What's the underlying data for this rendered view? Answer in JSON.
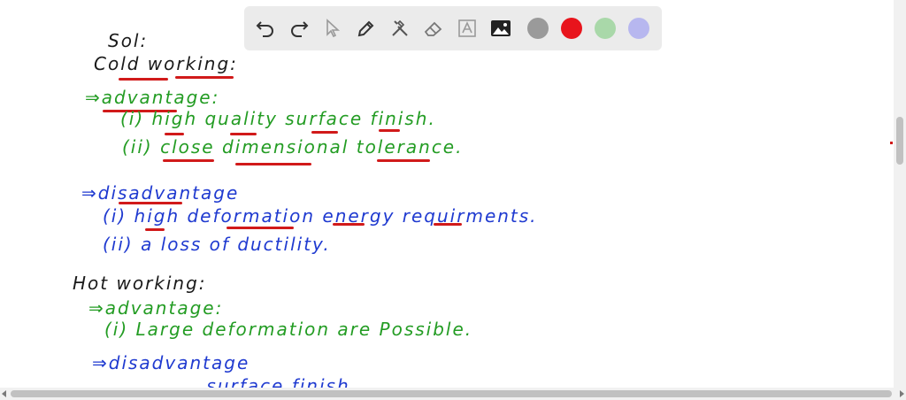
{
  "notes": {
    "sol": "Sol:",
    "cold_heading": "Cold working:",
    "cold_adv_heading": "⇒advantage:",
    "cold_adv_1": "(i) high quality surface finish.",
    "cold_adv_2": "(ii) close dimensional tolerance.",
    "cold_dis_heading": "⇒disadvantage",
    "cold_dis_1": "(i) high deformation energy requirments.",
    "cold_dis_2": "(ii) a loss of ductility.",
    "hot_heading": "Hot working:",
    "hot_adv_heading": "⇒advantage:",
    "hot_adv_1": "(i) Large deformation are Possible.",
    "hot_dis_heading": "⇒disadvantage",
    "hot_dis_1": "... surface finish."
  },
  "toolbar": {
    "tools": [
      "undo-icon",
      "redo-icon",
      "pointer-icon",
      "pen-icon",
      "tools-icon",
      "eraser-icon",
      "text-icon",
      "image-icon"
    ],
    "colors": [
      "#9a9a9a",
      "#e8141c",
      "#a9d8a9",
      "#b7b7ef"
    ]
  }
}
